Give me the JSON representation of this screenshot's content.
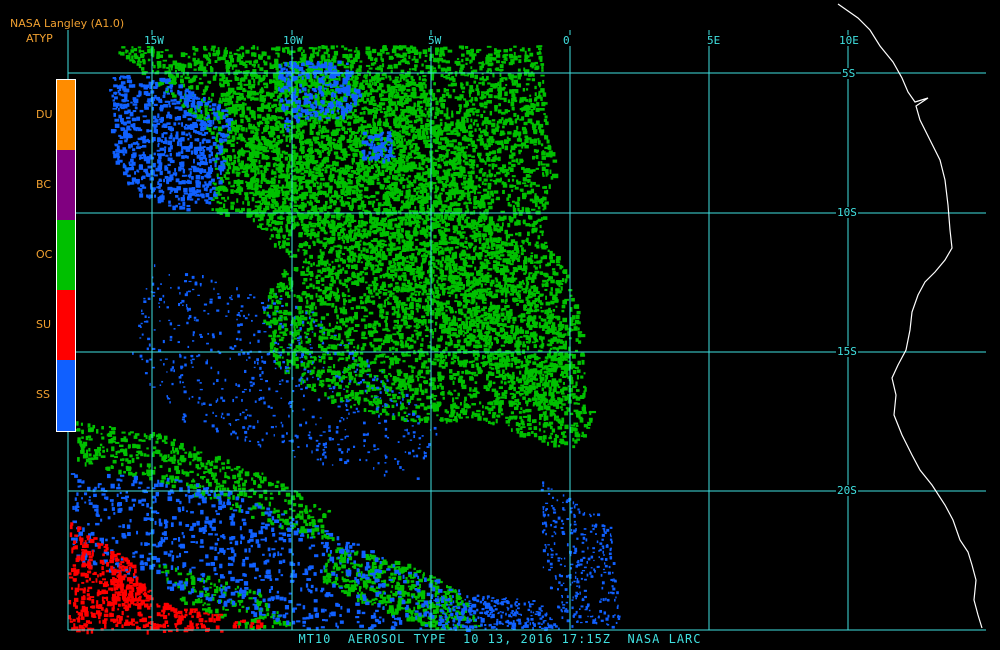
{
  "header": {
    "product": "NASA Langley (A1.0)",
    "field": "ATYP"
  },
  "legend": [
    {
      "code": "DU",
      "color": "#ff8c00"
    },
    {
      "code": "BC",
      "color": "#800080"
    },
    {
      "code": "OC",
      "color": "#00c000"
    },
    {
      "code": "SU",
      "color": "#ff0000"
    },
    {
      "code": "SS",
      "color": "#1060ff"
    }
  ],
  "grid": {
    "lon_labels": [
      "15W",
      "10W",
      "5W",
      "0",
      "5E",
      "10E"
    ],
    "lat_labels": [
      "5S",
      "10S",
      "15S",
      "20S"
    ],
    "color": "#40e0e0"
  },
  "colors": {
    "coastline": "#ffffff",
    "background": "#000000"
  },
  "footer": "MT10  AEROSOL TYPE  10 13, 2016 17:15Z  NASA LARC"
}
